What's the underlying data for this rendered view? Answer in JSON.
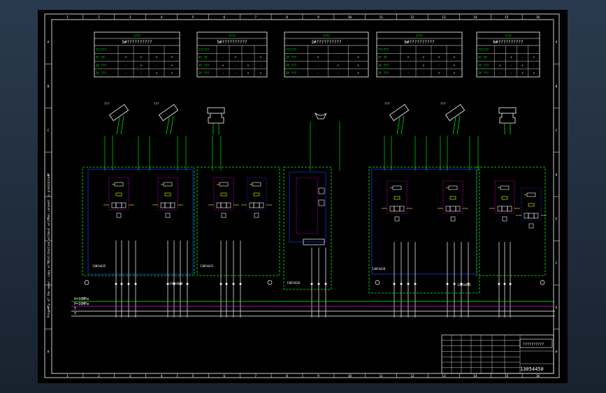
{
  "border": {
    "columns": [
      "1",
      "2",
      "3",
      "4",
      "5",
      "6",
      "7",
      "8",
      "9",
      "10",
      "11",
      "12",
      "13",
      "14",
      "15",
      "16"
    ],
    "rows": [
      "A",
      "B",
      "C",
      "D",
      "E",
      "F",
      "G",
      "H"
    ]
  },
  "tables": [
    {
      "header": "5#??????????",
      "rows": [
        [
          "??/???",
          "",
          "",
          "",
          ""
        ],
        [
          "X? 1Y",
          "+",
          "+",
          "+",
          "+"
        ],
        [
          "1Y ???",
          "-",
          "+",
          "-",
          "+"
        ],
        [
          "2Y ???",
          "-",
          "-",
          "+",
          "+"
        ]
      ]
    },
    {
      "header": "5#??????????",
      "rows": [
        [
          "??/???",
          "",
          "",
          "",
          ""
        ],
        [
          "X? 1Y",
          "-",
          "+",
          "-",
          "+"
        ],
        [
          "1Y ???",
          "+",
          "-",
          "+",
          "-"
        ],
        [
          "2Y ???",
          "-",
          "-",
          "+",
          "+"
        ]
      ]
    },
    {
      "header": "2#??????????",
      "rows": [
        [
          "??/???",
          "",
          "",
          ""
        ],
        [
          "1Y ???",
          "+",
          "-",
          "+"
        ],
        [
          "2Y ???",
          "-",
          "+",
          "+"
        ],
        [
          "3Y ???",
          "-",
          "-",
          "+"
        ]
      ]
    },
    {
      "header": "6#??????????",
      "rows": [
        [
          "??/???",
          "",
          "",
          "",
          ""
        ],
        [
          "X? 1Y",
          "+",
          "+",
          "+",
          "+"
        ],
        [
          "1Y ???",
          "-",
          "+",
          "-",
          "+"
        ],
        [
          "2Y ???",
          "-",
          "-",
          "+",
          "+"
        ]
      ]
    },
    {
      "header": "6#??????????",
      "rows": [
        [
          "??/???",
          "",
          "",
          "",
          ""
        ],
        [
          "X? 1Y",
          "-",
          "+",
          "-",
          "+"
        ],
        [
          "1Y ???",
          "+",
          "-",
          "+",
          "-"
        ],
        [
          "2Y ???",
          "-",
          "-",
          "+",
          "+"
        ]
      ]
    }
  ],
  "manifold_labels": [
    "13054425",
    "13054430",
    "13054431",
    "13054426",
    "13054428",
    "13054423"
  ],
  "pressure_lines": [
    "X=16MPa",
    "P=16MPa",
    "T",
    "Y"
  ],
  "title_block": {
    "drawing_number": "13054450",
    "company": "??????????"
  },
  "side_note": "Property of the owner: copy or distribution without written consent is prohibited",
  "colors": {
    "green": "#00ff00",
    "white": "#ffffff",
    "blue": "#1e40ff",
    "magenta": "#ff00ff",
    "yellow": "#ffff00",
    "red": "#ff2020",
    "cyan": "#00ffff"
  }
}
